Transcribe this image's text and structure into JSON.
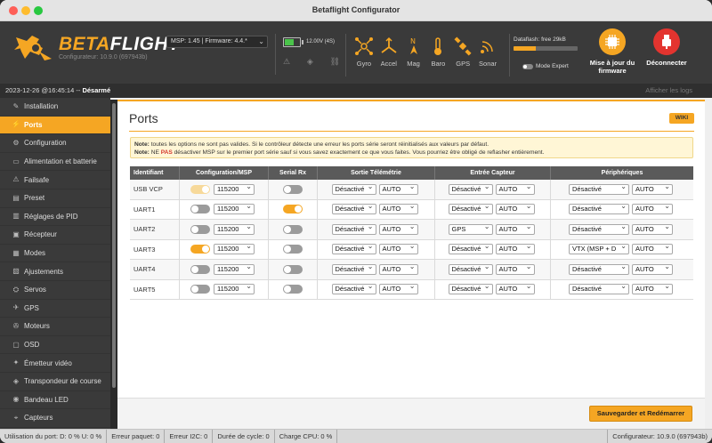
{
  "window": {
    "title": "Betaflight Configurator"
  },
  "header": {
    "logo_beta": "BETA",
    "logo_flight": "FLIGHT",
    "logo_sub": "Configurateur: 10.9.0 (697943b)",
    "firmware_select": "MSP: 1.45 | Firmware: 4.4.*",
    "battery_label": "12.00V (4S)",
    "sensors": [
      {
        "label": "Gyro",
        "icon": "gyro-icon"
      },
      {
        "label": "Accel",
        "icon": "accel-icon"
      },
      {
        "label": "Mag",
        "icon": "mag-icon"
      },
      {
        "label": "Baro",
        "icon": "baro-icon"
      },
      {
        "label": "GPS",
        "icon": "gps-icon"
      },
      {
        "label": "Sonar",
        "icon": "sonar-icon"
      }
    ],
    "dataflash_label": "Dataflash: free 29kB",
    "dataflash_used": 0.35,
    "expert_mode_label": "Mode Expert",
    "update_fw_label_1": "Mise à jour du",
    "update_fw_label_2": "firmware",
    "disconnect_label": "Déconnecter"
  },
  "strip": {
    "date": "2023-12-26 @16:45:14",
    "separator": " -- ",
    "state": "Désarmé",
    "show_logs": "Afficher les logs"
  },
  "sidebar": {
    "items": [
      {
        "label": "Installation",
        "icon": "wrench-icon",
        "glyph": "✎"
      },
      {
        "label": "Ports",
        "icon": "plug-icon",
        "glyph": "⚡"
      },
      {
        "label": "Configuration",
        "icon": "gear-icon",
        "glyph": "⚙"
      },
      {
        "label": "Alimentation et batterie",
        "icon": "battery-icon",
        "glyph": "▭"
      },
      {
        "label": "Failsafe",
        "icon": "failsafe-icon",
        "glyph": "⚠"
      },
      {
        "label": "Preset",
        "icon": "preset-icon",
        "glyph": "▤"
      },
      {
        "label": "Réglages de PID",
        "icon": "pid-icon",
        "glyph": "▥"
      },
      {
        "label": "Récepteur",
        "icon": "receiver-icon",
        "glyph": "▣"
      },
      {
        "label": "Modes",
        "icon": "modes-icon",
        "glyph": "▦"
      },
      {
        "label": "Ajustements",
        "icon": "adjustments-icon",
        "glyph": "▧"
      },
      {
        "label": "Servos",
        "icon": "servo-icon",
        "glyph": "⛭"
      },
      {
        "label": "GPS",
        "icon": "gps-icon",
        "glyph": "✈"
      },
      {
        "label": "Moteurs",
        "icon": "motor-icon",
        "glyph": "✇"
      },
      {
        "label": "OSD",
        "icon": "osd-icon",
        "glyph": "▢"
      },
      {
        "label": "Émetteur vidéo",
        "icon": "vtx-icon",
        "glyph": "✦"
      },
      {
        "label": "Transpondeur de course",
        "icon": "transponder-icon",
        "glyph": "◈"
      },
      {
        "label": "Bandeau LED",
        "icon": "led-icon",
        "glyph": "◉"
      },
      {
        "label": "Capteurs",
        "icon": "sensors-icon",
        "glyph": "⌖"
      }
    ]
  },
  "content": {
    "title": "Ports",
    "wiki": "WIKI",
    "note1_label": "Note:",
    "note1_text": " toutes les options ne sont pas valides. Si le contrôleur détecte une erreur les ports série seront réinitialisés aux valeurs par défaut.",
    "note2_label": "Note:",
    "note2_pre": " NE ",
    "note2_pas": "PAS",
    "note2_text": " désactiver MSP sur le premier port série sauf si vous savez exactement ce que vous faites. Vous pourriez être obligé de reflasher entièrement.",
    "columns": [
      "Identifiant",
      "Configuration/MSP",
      "Serial Rx",
      "Sortie Télémétrie",
      "Entrée Capteur",
      "Périphériques"
    ],
    "rows": [
      {
        "id": "USB VCP",
        "msp": "half",
        "baud": "115200",
        "rx": false,
        "tel": "Désactivé",
        "tel_auto": "AUTO",
        "sen": "Désactivé",
        "sen_auto": "AUTO",
        "per": "Désactivé",
        "per_auto": "AUTO"
      },
      {
        "id": "UART1",
        "msp": "off",
        "baud": "115200",
        "rx": true,
        "tel": "Désactivé",
        "tel_auto": "AUTO",
        "sen": "Désactivé",
        "sen_auto": "AUTO",
        "per": "Désactivé",
        "per_auto": "AUTO"
      },
      {
        "id": "UART2",
        "msp": "off",
        "baud": "115200",
        "rx": false,
        "tel": "Désactivé",
        "tel_auto": "AUTO",
        "sen": "GPS",
        "sen_auto": "AUTO",
        "per": "Désactivé",
        "per_auto": "AUTO"
      },
      {
        "id": "UART3",
        "msp": "on",
        "baud": "115200",
        "rx": false,
        "tel": "Désactivé",
        "tel_auto": "AUTO",
        "sen": "Désactivé",
        "sen_auto": "AUTO",
        "per": "VTX (MSP + D",
        "per_auto": "AUTO"
      },
      {
        "id": "UART4",
        "msp": "off",
        "baud": "115200",
        "rx": false,
        "tel": "Désactivé",
        "tel_auto": "AUTO",
        "sen": "Désactivé",
        "sen_auto": "AUTO",
        "per": "Désactivé",
        "per_auto": "AUTO"
      },
      {
        "id": "UART5",
        "msp": "off",
        "baud": "115200",
        "rx": false,
        "tel": "Désactivé",
        "tel_auto": "AUTO",
        "sen": "Désactivé",
        "sen_auto": "AUTO",
        "per": "Désactivé",
        "per_auto": "AUTO"
      }
    ],
    "save_button": "Sauvegarder et Redémarrer"
  },
  "footer": {
    "port_usage": "Utilisation du port: D: 0 % U: 0 %",
    "packet_error": "Erreur paquet: 0",
    "i2c_error": "Erreur I2C: 0",
    "cycle_time": "Durée de cycle: 0",
    "cpu_load": "Charge CPU: 0 %",
    "configurator": "Configurateur: 10.9.0 (697943b)"
  },
  "colors": {
    "accent": "#f5a623",
    "header_bg": "#3a3a3a",
    "disconnect": "#e3342f"
  }
}
